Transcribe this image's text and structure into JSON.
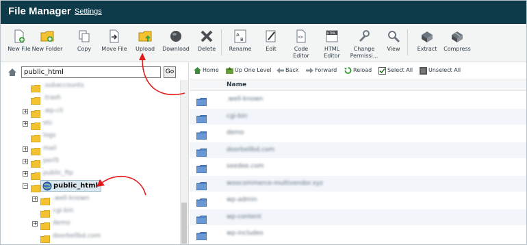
{
  "header": {
    "title": "File Manager",
    "settings_link": "Settings"
  },
  "toolbar": {
    "buttons": [
      {
        "label": "New File",
        "icon": "new-file-icon"
      },
      {
        "label": "New Folder",
        "icon": "new-folder-icon"
      },
      {
        "label": "Copy",
        "icon": "copy-icon"
      },
      {
        "label": "Move File",
        "icon": "move-file-icon"
      },
      {
        "label": "Upload",
        "icon": "upload-icon"
      },
      {
        "label": "Download",
        "icon": "download-icon"
      },
      {
        "label": "Delete",
        "icon": "delete-icon"
      },
      {
        "label": "Rename",
        "icon": "rename-icon"
      },
      {
        "label": "Edit",
        "icon": "edit-icon"
      },
      {
        "label": "Code Editor",
        "icon": "code-editor-icon"
      },
      {
        "label": "HTML Editor",
        "icon": "html-editor-icon"
      },
      {
        "label": "Change Permissi...",
        "icon": "change-permissions-icon"
      },
      {
        "label": "View",
        "icon": "view-icon"
      },
      {
        "label": "Extract",
        "icon": "extract-icon"
      },
      {
        "label": "Compress",
        "icon": "compress-icon"
      }
    ]
  },
  "left_pane": {
    "path_value": "public_html",
    "go_label": "Go",
    "tree": [
      {
        "label": ".subaccounts",
        "indent": 1,
        "expander": false,
        "blurred": true
      },
      {
        "label": ".trash",
        "indent": 1,
        "expander": false,
        "blurred": true
      },
      {
        "label": ".wp-cli",
        "indent": 1,
        "expander": true,
        "blurred": true
      },
      {
        "label": "etc",
        "indent": 1,
        "expander": true,
        "blurred": true
      },
      {
        "label": "logs",
        "indent": 1,
        "expander": false,
        "blurred": true
      },
      {
        "label": "mail",
        "indent": 1,
        "expander": true,
        "blurred": true
      },
      {
        "label": "perl5",
        "indent": 1,
        "expander": true,
        "blurred": true
      },
      {
        "label": "public_ftp",
        "indent": 1,
        "expander": true,
        "blurred": true
      },
      {
        "label": "public_html",
        "indent": 1,
        "expander": true,
        "blurred": false,
        "selected": true
      },
      {
        "label": ".well-known",
        "indent": 2,
        "expander": true,
        "blurred": true
      },
      {
        "label": "cgi-bin",
        "indent": 2,
        "expander": false,
        "blurred": true
      },
      {
        "label": "demo",
        "indent": 2,
        "expander": true,
        "blurred": true
      },
      {
        "label": "doorbellbd.com",
        "indent": 2,
        "expander": false,
        "blurred": true
      }
    ]
  },
  "nav": {
    "home": "Home",
    "up_one_level": "Up One Level",
    "back": "Back",
    "forward": "Forward",
    "reload": "Reload",
    "select_all": "Select All",
    "unselect_all": "Unselect All"
  },
  "table": {
    "name_header": "Name",
    "rows": [
      ".well-known",
      "cgi-bin",
      "demo",
      "doorbellbd.com",
      "seedee.com",
      "woocommerce-multivendor.xyz",
      "wp-admin",
      "wp-content",
      "wp-includes"
    ]
  },
  "colors": {
    "header_bg": "#0e3b4a",
    "annotation_arrow": "#e31b1b",
    "folder_yellow": "#f2c230",
    "folder_blue": "#4f7fbf"
  }
}
